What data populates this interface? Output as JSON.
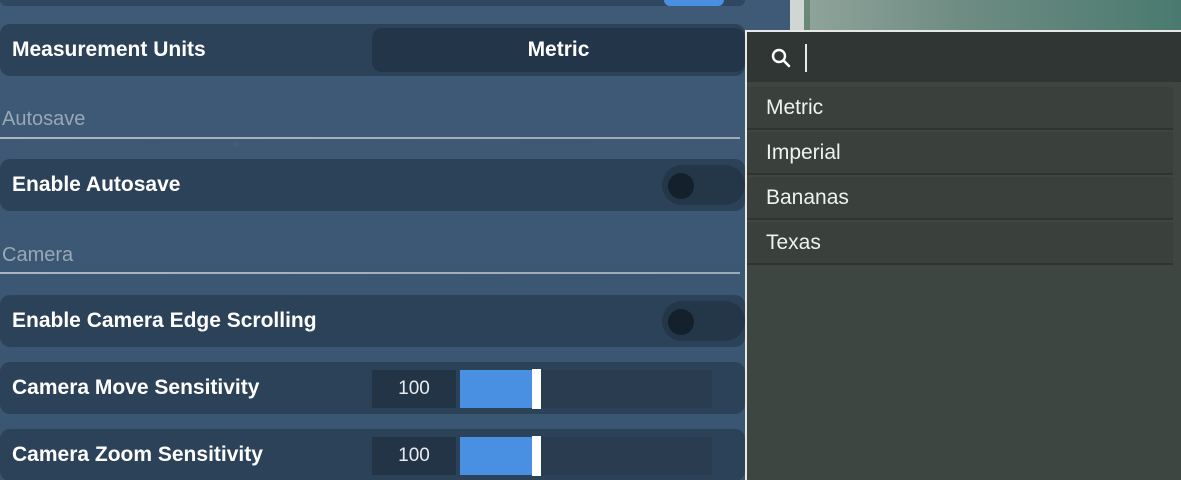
{
  "settings": {
    "measurement_units": {
      "label": "Measurement Units",
      "value": "Metric"
    },
    "sections": {
      "autosave": "Autosave",
      "camera": "Camera"
    },
    "enable_autosave": {
      "label": "Enable Autosave",
      "on": false
    },
    "enable_camera_edge_scrolling": {
      "label": "Enable Camera Edge Scrolling",
      "on": false
    },
    "camera_move_sensitivity": {
      "label": "Camera Move Sensitivity",
      "value": "100",
      "fill_fraction": 0.3
    },
    "camera_zoom_sensitivity": {
      "label": "Camera Zoom Sensitivity",
      "value": "100",
      "fill_fraction": 0.3
    }
  },
  "dropdown": {
    "search_value": "",
    "options": [
      "Metric",
      "Imperial",
      "Bananas",
      "Texas"
    ]
  },
  "colors": {
    "accent": "#4a90e2",
    "panel_bg": "#3c5774",
    "row_bg": "#2c4259",
    "popup_bg": "#3e4641"
  },
  "icons": {
    "search": "search-icon"
  }
}
